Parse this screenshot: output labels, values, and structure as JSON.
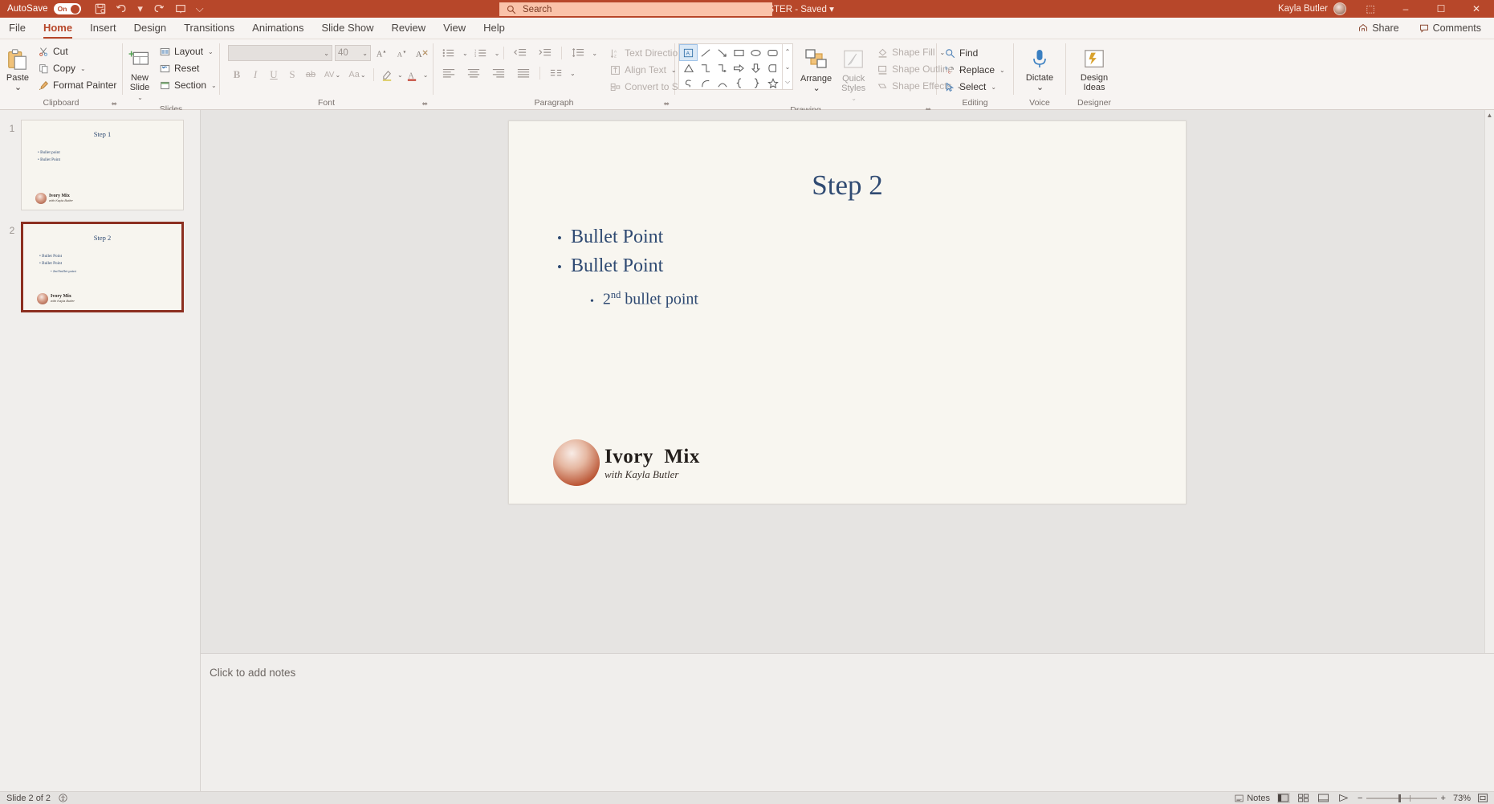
{
  "titlebar": {
    "autosave_label": "AutoSave",
    "autosave_state": "On",
    "document_title": "Ivory Mix Presentation MASTER",
    "save_state": "- Saved",
    "title_caret": "▾",
    "quick_access": [
      {
        "name": "save-icon",
        "glyph": "❐"
      },
      {
        "name": "undo-icon",
        "glyph": "↶"
      },
      {
        "name": "undo-dropdown-icon",
        "glyph": "▾"
      },
      {
        "name": "redo-icon",
        "glyph": "↻"
      },
      {
        "name": "start-presentation-icon",
        "glyph": "⬜"
      },
      {
        "name": "customize-quick-access-icon",
        "glyph": "⌵"
      }
    ],
    "search_placeholder": "Search",
    "search_icon": "⌕",
    "user_name": "Kayla Butler",
    "ribbon_display_icon": "⬚",
    "minimize_icon": "‒",
    "maximize_icon": "☐",
    "close_icon": "✕"
  },
  "tabs": [
    {
      "label": "File",
      "active": false
    },
    {
      "label": "Home",
      "active": true
    },
    {
      "label": "Insert",
      "active": false
    },
    {
      "label": "Design",
      "active": false
    },
    {
      "label": "Transitions",
      "active": false
    },
    {
      "label": "Animations",
      "active": false
    },
    {
      "label": "Slide Show",
      "active": false
    },
    {
      "label": "Review",
      "active": false
    },
    {
      "label": "View",
      "active": false
    },
    {
      "label": "Help",
      "active": false
    }
  ],
  "tabbar_right": [
    {
      "label": "Share",
      "icon": "↱"
    },
    {
      "label": "Comments",
      "icon": "⌸"
    }
  ],
  "ribbon": {
    "clipboard": {
      "group_name": "Clipboard",
      "dialog_launcher": "⬌",
      "paste_label": "Paste",
      "paste_caret": "⌄",
      "items": [
        {
          "label": "Cut",
          "icon": "✂"
        },
        {
          "label": "Copy",
          "icon": "❐",
          "caret": "⌄"
        },
        {
          "label": "Format Painter",
          "icon": "✎"
        }
      ]
    },
    "slides": {
      "group_name": "Slides",
      "new_slide_label_1": "New",
      "new_slide_label_2": "Slide",
      "new_slide_caret": "⌄",
      "items": [
        {
          "label": "Layout",
          "caret": "⌄"
        },
        {
          "label": "Reset",
          "caret": ""
        },
        {
          "label": "Section",
          "caret": "⌄"
        }
      ]
    },
    "font": {
      "group_name": "Font",
      "dialog_launcher": "⬌",
      "font_name_value": "",
      "font_size_value": "40",
      "dropdown_caret": "⌄",
      "buttons_row1": [
        {
          "name": "increase-font-size-button",
          "glyph": "A▴"
        },
        {
          "name": "decrease-font-size-button",
          "glyph": "A▾"
        },
        {
          "name": "clear-formatting-button",
          "glyph": "A⊘"
        }
      ],
      "buttons_row2": [
        {
          "name": "bold-button",
          "glyph": "B"
        },
        {
          "name": "italic-button",
          "glyph": "I"
        },
        {
          "name": "underline-button",
          "glyph": "U"
        },
        {
          "name": "text-shadow-button",
          "glyph": "S"
        },
        {
          "name": "strikethrough-button",
          "glyph": "ab"
        },
        {
          "name": "character-spacing-button",
          "glyph": "AV",
          "caret": "⌄"
        },
        {
          "name": "change-case-button",
          "glyph": "Aa",
          "caret": "⌄"
        },
        {
          "name": "text-highlight-color-button",
          "glyph": "✐",
          "caret": "⌄"
        },
        {
          "name": "font-color-button",
          "glyph": "A",
          "caret": "⌄"
        }
      ]
    },
    "paragraph": {
      "group_name": "Paragraph",
      "dialog_launcher": "⬌",
      "row1": [
        {
          "name": "bullets-button",
          "glyph": "☰",
          "caret": "⌄"
        },
        {
          "name": "numbering-button",
          "glyph": "☰",
          "caret": "⌄"
        },
        {
          "name": "decrease-indent-button",
          "glyph": "⇤"
        },
        {
          "name": "increase-indent-button",
          "glyph": "⇥"
        },
        {
          "name": "line-spacing-button",
          "glyph": "↕",
          "caret": "⌄"
        }
      ],
      "row2": [
        {
          "name": "align-left-button",
          "glyph": "≡"
        },
        {
          "name": "align-center-button",
          "glyph": "≡"
        },
        {
          "name": "align-right-button",
          "glyph": "≡"
        },
        {
          "name": "justify-button",
          "glyph": "≡"
        },
        {
          "name": "columns-button",
          "glyph": "☷",
          "caret": "⌄"
        }
      ],
      "right_items": [
        {
          "label": "Text Direction",
          "caret": "⌄",
          "icon": "↕"
        },
        {
          "label": "Align Text",
          "caret": "⌄",
          "icon": "⊞"
        },
        {
          "label": "Convert to SmartArt",
          "caret": "⌄",
          "icon": "▦"
        }
      ]
    },
    "drawing": {
      "group_name": "Drawing",
      "dialog_launcher": "⬌",
      "shapes": [
        "A",
        "╲",
        "↘",
        "▭",
        "◯",
        "▢",
        "△",
        "⌐",
        "⌙",
        "⇨",
        "⇩",
        "◖",
        "ℎ",
        "⌒",
        "⁀",
        "{",
        "}",
        "☆"
      ],
      "scroll_up": "⌃",
      "scroll_down": "⌄",
      "scroll_more": "⌵",
      "arrange_label": "Arrange",
      "arrange_caret": "⌄",
      "quick_styles_label_1": "Quick",
      "quick_styles_label_2": "Styles",
      "quick_styles_caret": "⌄",
      "items": [
        {
          "label": "Shape Fill",
          "caret": "⌄"
        },
        {
          "label": "Shape Outline",
          "caret": "⌄"
        },
        {
          "label": "Shape Effects",
          "caret": "⌄"
        }
      ]
    },
    "editing": {
      "group_name": "Editing",
      "items": [
        {
          "label": "Find",
          "icon": "⌕"
        },
        {
          "label": "Replace",
          "icon": "⬌",
          "caret": "⌄"
        },
        {
          "label": "Select",
          "icon": "➤",
          "caret": "⌄"
        }
      ]
    },
    "voice": {
      "group_name": "Voice",
      "dictate_label": "Dictate",
      "dictate_caret": "⌄"
    },
    "designer": {
      "group_name": "Designer",
      "design_ideas_label_1": "Design",
      "design_ideas_label_2": "Ideas"
    }
  },
  "thumbnails": [
    {
      "number": "1",
      "title": "Step 1",
      "bullets": [
        "Bullet point",
        "Bullet Point"
      ],
      "subbullets": [],
      "selected": false,
      "logo_name": "Ivory Mix",
      "logo_tagline": "with Kayla Butler"
    },
    {
      "number": "2",
      "title": "Step 2",
      "bullets": [
        "Bullet Point",
        "Bullet Point"
      ],
      "subbullets": [
        "2nd bullet point"
      ],
      "selected": true,
      "logo_name": "Ivory Mix",
      "logo_tagline": "with Kayla Butler"
    }
  ],
  "slide": {
    "title": "Step 2",
    "bullets": [
      {
        "text": "Bullet Point",
        "level": 1
      },
      {
        "text": "Bullet Point",
        "level": 1
      }
    ],
    "sub_bullet_prefix": "2",
    "sub_bullet_sup": "nd",
    "sub_bullet_rest": " bullet point",
    "logo_name_1": "Ivory",
    "logo_name_2": "Mix",
    "logo_tagline": "with Kayla Butler"
  },
  "notes": {
    "placeholder": "Click to add notes"
  },
  "statusbar": {
    "slide_indicator": "Slide 2 of 2",
    "accessibility_icon": "♿",
    "notes_label": "Notes",
    "notes_icon": "☰",
    "views": [
      {
        "name": "normal-view-button",
        "glyph": "▤",
        "active": true
      },
      {
        "name": "slide-sorter-view-button",
        "glyph": "☷",
        "active": false
      },
      {
        "name": "reading-view-button",
        "glyph": "▭",
        "active": false
      },
      {
        "name": "slide-show-button",
        "glyph": "▷",
        "active": false
      }
    ],
    "zoom_out_icon": "−",
    "zoom_in_icon": "+",
    "zoom_level": "73%",
    "fit_icon": "⬚"
  },
  "colors": {
    "accent": "#b7472a",
    "slide_text": "#2f4a72",
    "selected_thumb_border": "#8c2f20",
    "search_bg": "#fac3aa"
  }
}
